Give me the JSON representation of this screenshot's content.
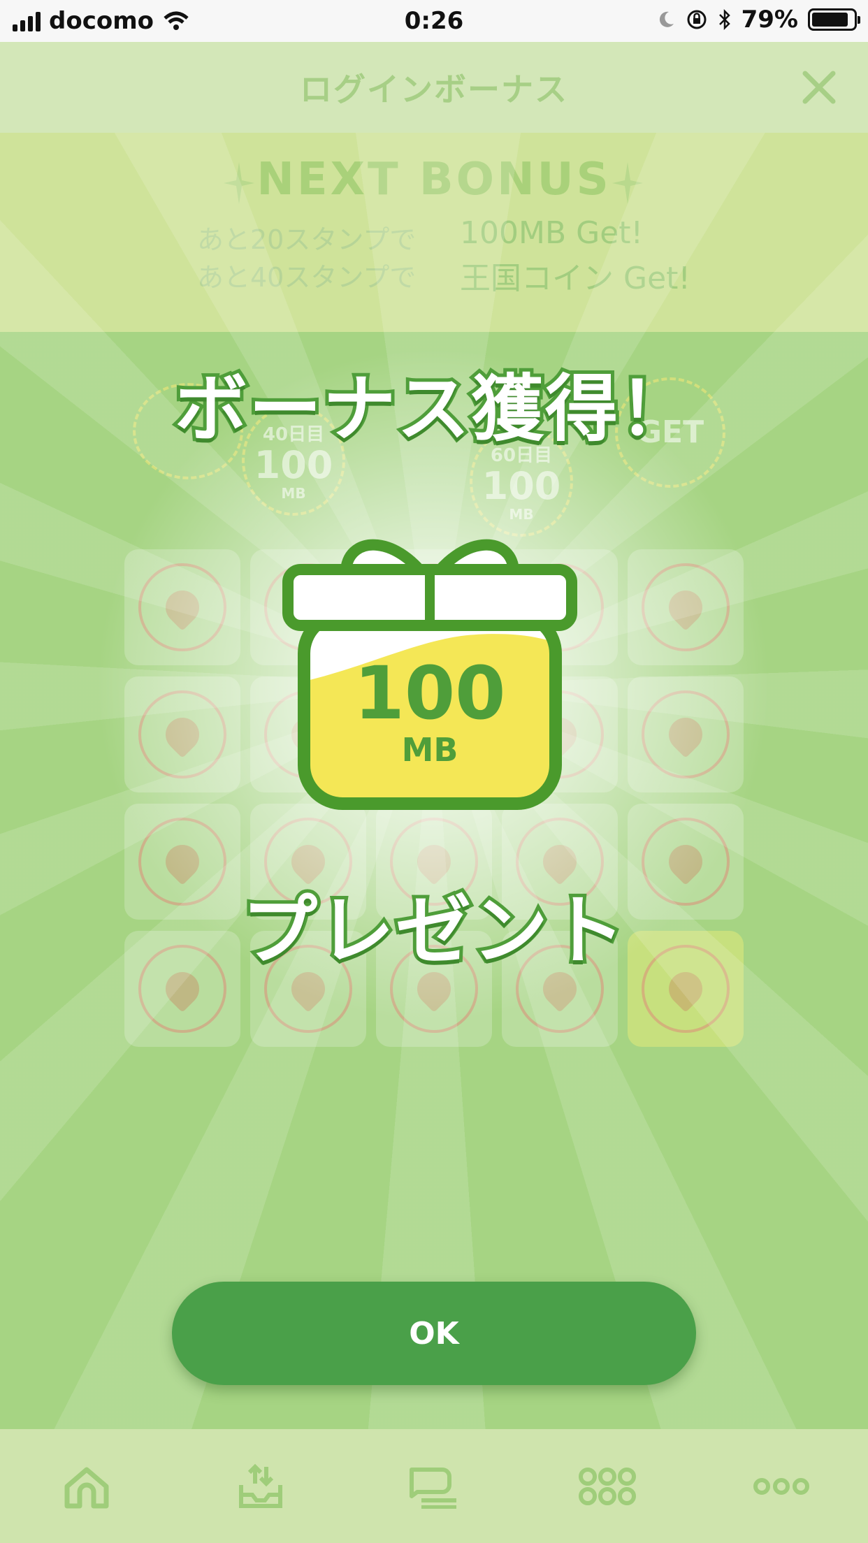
{
  "status_bar": {
    "carrier": "docomo",
    "time": "0:26",
    "battery_percent": "79%",
    "battery_level": 0.79
  },
  "header": {
    "title": "ログインボーナス",
    "close_icon": "close-icon"
  },
  "next_bonus": {
    "title": "NEXT BONUS",
    "rows": [
      {
        "condition": "あと20スタンプで",
        "reward": "100MB Get!"
      },
      {
        "condition": "あと40スタンプで",
        "reward": "王国コイン Get!"
      }
    ]
  },
  "progress_path": [
    {
      "day": "40日目",
      "value": "100",
      "unit": "MB"
    },
    {
      "day": "60日目",
      "value": "100",
      "unit": "MB"
    }
  ],
  "progress_end_label": "GET",
  "popup": {
    "headline": "ボーナス獲得！",
    "gift_value": "100",
    "gift_unit": "MB",
    "subtitle": "プレゼント",
    "ok_label": "OK"
  },
  "tabbar": {
    "items": [
      "home-icon",
      "download-tray-icon",
      "chat-list-icon",
      "apps-grid-icon",
      "more-dots-icon"
    ]
  },
  "colors": {
    "brand_green": "#4aa049",
    "gift_yellow": "#f4e756"
  }
}
